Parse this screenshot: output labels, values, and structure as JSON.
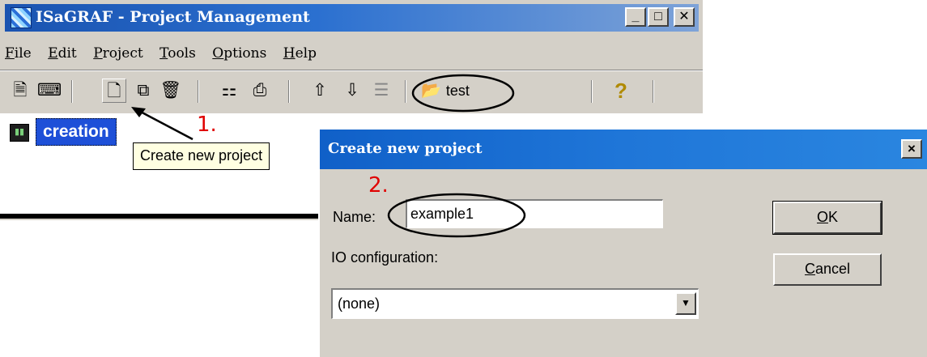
{
  "main_window": {
    "title": "ISaGRAF - Project Management",
    "controls": {
      "minimize": "_",
      "maximize": "□",
      "close": "✕"
    }
  },
  "menu": [
    "File",
    "Edit",
    "Project",
    "Tools",
    "Options",
    "Help"
  ],
  "toolbar": {
    "project_selector_label": "test",
    "help_symbol": "?",
    "icons": [
      "page-icon",
      "edit-icon",
      "new-project-icon",
      "copy-icon",
      "delete-icon",
      "diff-icon",
      "print-icon",
      "arrow-up-icon",
      "arrow-down-icon",
      "lines-icon",
      "open-folder-icon",
      "help-icon"
    ]
  },
  "tree": {
    "selected_item": "creation"
  },
  "tooltip": "Create new project",
  "annotations": {
    "step1": "1.",
    "step2": "2."
  },
  "dialog": {
    "title": "Create new project",
    "close_symbol": "×",
    "name_label": "Name:",
    "name_value": "example1",
    "io_label": "IO configuration:",
    "io_value": "(none)",
    "ok_label": "OK",
    "cancel_label": "Cancel"
  },
  "colors": {
    "titlebar_blue": "#1a53b0",
    "dialog_blue": "#1f76d8",
    "tooltip_bg": "#ffffe1",
    "annotation_red": "#e00000"
  }
}
